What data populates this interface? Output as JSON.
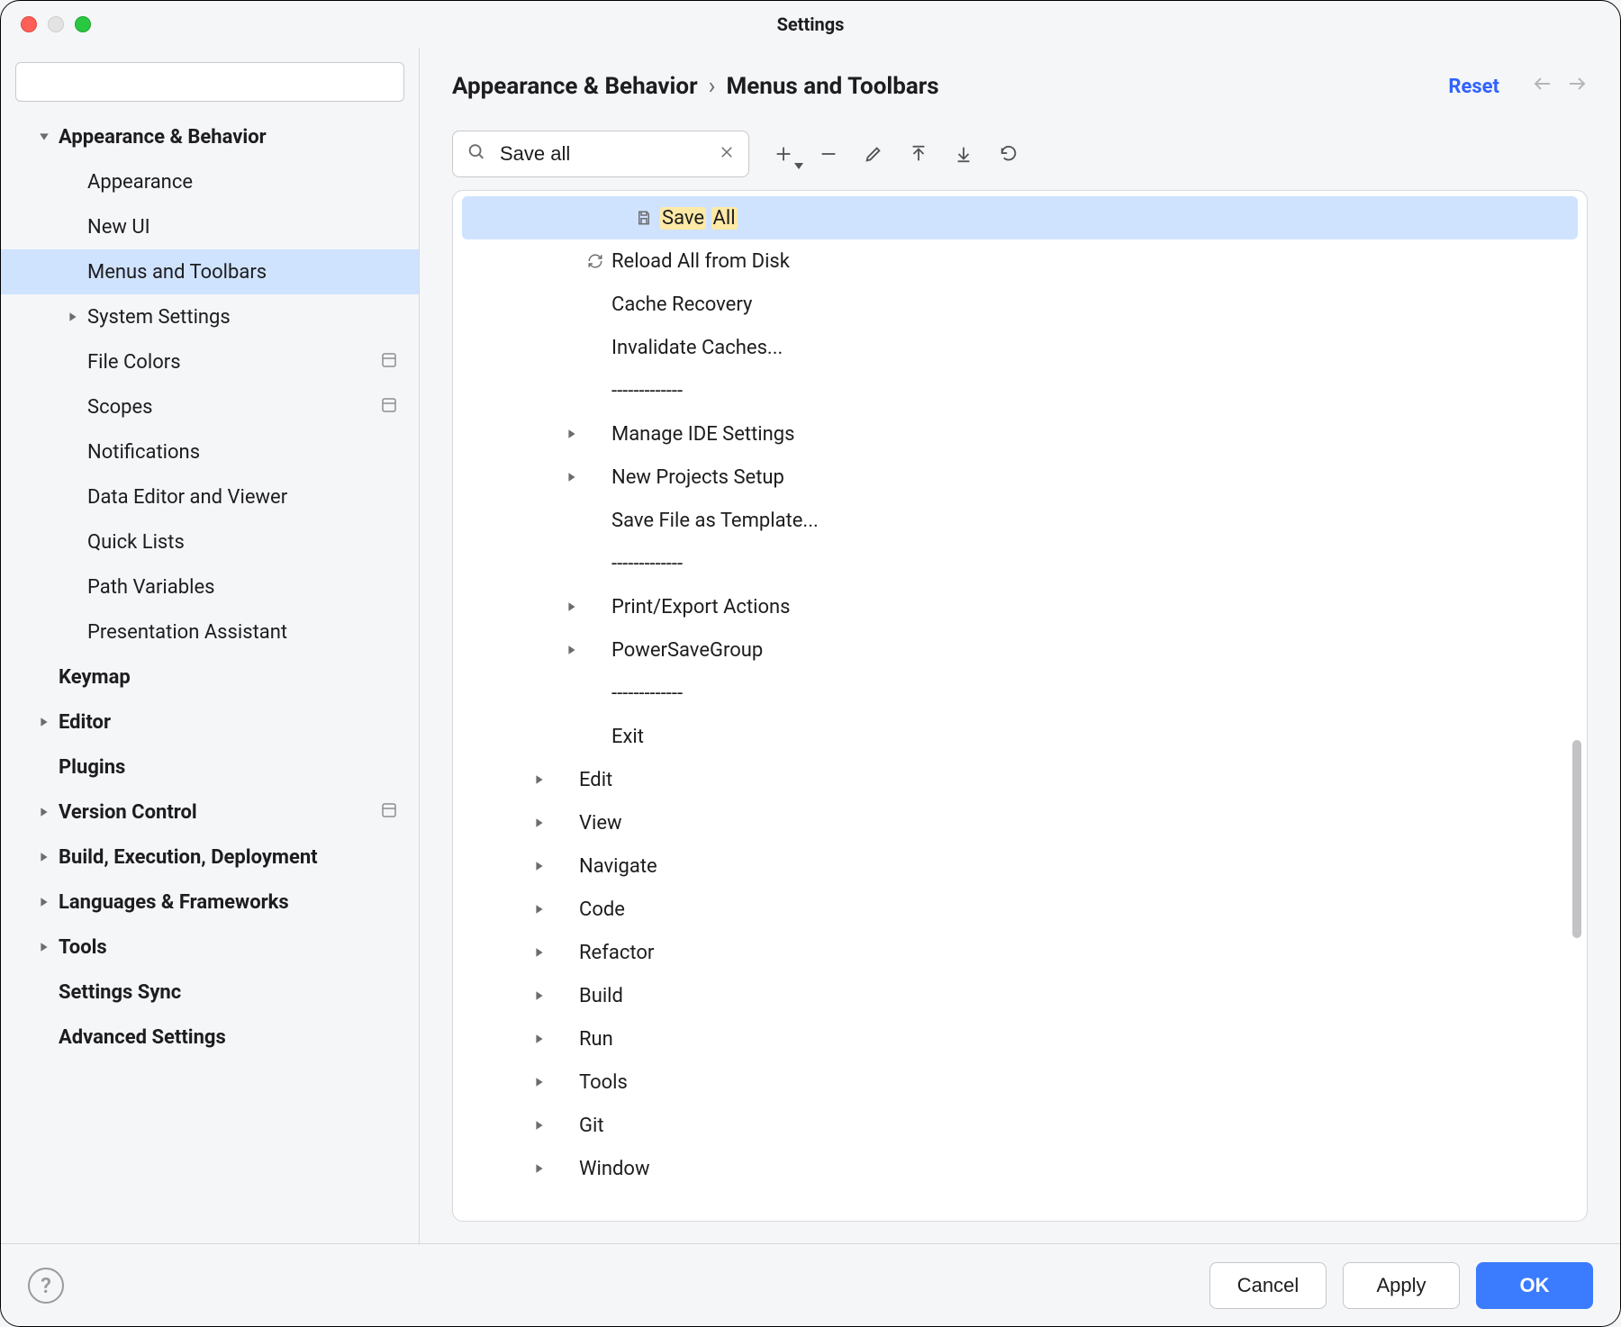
{
  "window": {
    "title": "Settings"
  },
  "sidebar": {
    "search_placeholder": "",
    "items": [
      {
        "label": "Appearance & Behavior",
        "bold": true,
        "arrow": "down",
        "indent": 0
      },
      {
        "label": "Appearance",
        "bold": false,
        "arrow": "none",
        "indent": 1
      },
      {
        "label": "New UI",
        "bold": false,
        "arrow": "none",
        "indent": 1
      },
      {
        "label": "Menus and Toolbars",
        "bold": false,
        "arrow": "none",
        "indent": 1,
        "selected": true
      },
      {
        "label": "System Settings",
        "bold": false,
        "arrow": "right",
        "indent": 1
      },
      {
        "label": "File Colors",
        "bold": false,
        "arrow": "none",
        "indent": 1,
        "trail": true
      },
      {
        "label": "Scopes",
        "bold": false,
        "arrow": "none",
        "indent": 1,
        "trail": true
      },
      {
        "label": "Notifications",
        "bold": false,
        "arrow": "none",
        "indent": 1
      },
      {
        "label": "Data Editor and Viewer",
        "bold": false,
        "arrow": "none",
        "indent": 1
      },
      {
        "label": "Quick Lists",
        "bold": false,
        "arrow": "none",
        "indent": 1
      },
      {
        "label": "Path Variables",
        "bold": false,
        "arrow": "none",
        "indent": 1
      },
      {
        "label": "Presentation Assistant",
        "bold": false,
        "arrow": "none",
        "indent": 1
      },
      {
        "label": "Keymap",
        "bold": true,
        "arrow": "none",
        "indent": 0
      },
      {
        "label": "Editor",
        "bold": true,
        "arrow": "right",
        "indent": 0
      },
      {
        "label": "Plugins",
        "bold": true,
        "arrow": "none",
        "indent": 0
      },
      {
        "label": "Version Control",
        "bold": true,
        "arrow": "right",
        "indent": 0,
        "trail": true
      },
      {
        "label": "Build, Execution, Deployment",
        "bold": true,
        "arrow": "right",
        "indent": 0
      },
      {
        "label": "Languages & Frameworks",
        "bold": true,
        "arrow": "right",
        "indent": 0
      },
      {
        "label": "Tools",
        "bold": true,
        "arrow": "right",
        "indent": 0
      },
      {
        "label": "Settings Sync",
        "bold": true,
        "arrow": "none",
        "indent": 0
      },
      {
        "label": "Advanced Settings",
        "bold": true,
        "arrow": "none",
        "indent": 0
      }
    ]
  },
  "header": {
    "breadcrumb_parent": "Appearance & Behavior",
    "breadcrumb_sep": "›",
    "breadcrumb_current": "Menus and Toolbars",
    "reset_label": "Reset"
  },
  "toolbar": {
    "filter_value": "Save all"
  },
  "actions": [
    {
      "indent": 2,
      "arrow": false,
      "icon": "save",
      "highlight": [
        "Save ",
        "All"
      ],
      "selected": true
    },
    {
      "indent": 2,
      "arrow": false,
      "icon": "reload",
      "label": "Reload All from Disk"
    },
    {
      "indent": 2,
      "arrow": false,
      "icon": "",
      "label": "Cache Recovery"
    },
    {
      "indent": 2,
      "arrow": false,
      "icon": "",
      "label": "Invalidate Caches..."
    },
    {
      "indent": 2,
      "arrow": false,
      "icon": "",
      "label": "-------------"
    },
    {
      "indent": 2,
      "arrow": true,
      "icon": "",
      "label": "Manage IDE Settings"
    },
    {
      "indent": 2,
      "arrow": true,
      "icon": "",
      "label": "New Projects Setup"
    },
    {
      "indent": 2,
      "arrow": false,
      "icon": "",
      "label": "Save File as Template..."
    },
    {
      "indent": 2,
      "arrow": false,
      "icon": "",
      "label": "-------------"
    },
    {
      "indent": 2,
      "arrow": true,
      "icon": "",
      "label": "Print/Export Actions"
    },
    {
      "indent": 2,
      "arrow": true,
      "icon": "",
      "label": "PowerSaveGroup"
    },
    {
      "indent": 2,
      "arrow": false,
      "icon": "",
      "label": "-------------"
    },
    {
      "indent": 2,
      "arrow": false,
      "icon": "",
      "label": "Exit"
    },
    {
      "indent": 1,
      "arrow": true,
      "icon": "",
      "label": "Edit"
    },
    {
      "indent": 1,
      "arrow": true,
      "icon": "",
      "label": "View"
    },
    {
      "indent": 1,
      "arrow": true,
      "icon": "",
      "label": "Navigate"
    },
    {
      "indent": 1,
      "arrow": true,
      "icon": "",
      "label": "Code"
    },
    {
      "indent": 1,
      "arrow": true,
      "icon": "",
      "label": "Refactor"
    },
    {
      "indent": 1,
      "arrow": true,
      "icon": "",
      "label": "Build"
    },
    {
      "indent": 1,
      "arrow": true,
      "icon": "",
      "label": "Run"
    },
    {
      "indent": 1,
      "arrow": true,
      "icon": "",
      "label": "Tools"
    },
    {
      "indent": 1,
      "arrow": true,
      "icon": "",
      "label": "Git"
    },
    {
      "indent": 1,
      "arrow": true,
      "icon": "",
      "label": "Window"
    }
  ],
  "footer": {
    "cancel_label": "Cancel",
    "apply_label": "Apply",
    "ok_label": "OK"
  }
}
